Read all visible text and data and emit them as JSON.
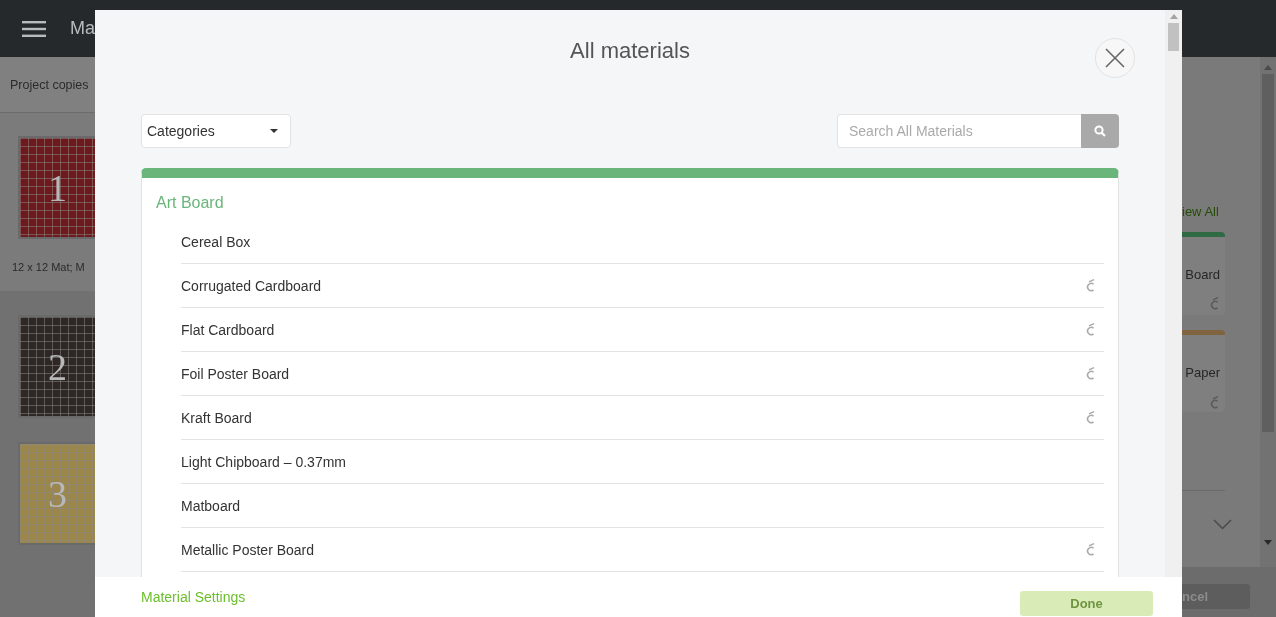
{
  "background": {
    "app_title": "Ma",
    "project_copies": "Project copies",
    "mats": [
      {
        "number": "1",
        "color": "#6e1a1c"
      },
      {
        "number": "2",
        "color": "#2e2724"
      },
      {
        "number": "3",
        "color": "#9c8648"
      }
    ],
    "mat_caption": "12 x 12 Mat; M",
    "view_all": "iew All",
    "material_cards": [
      {
        "label": "Board",
        "color": "#2f6a45"
      },
      {
        "label": "Paper",
        "color": "#80643f"
      }
    ],
    "cancel_button": "ncel"
  },
  "dialog": {
    "title": "All materials",
    "categories": {
      "value": "Categories"
    },
    "search": {
      "placeholder": "Search All Materials"
    },
    "section": {
      "title": "Art Board",
      "items": [
        {
          "name": "Cereal Box",
          "icon": false
        },
        {
          "name": "Corrugated Cardboard",
          "icon": true
        },
        {
          "name": "Flat Cardboard",
          "icon": true
        },
        {
          "name": "Foil Poster Board",
          "icon": true
        },
        {
          "name": "Kraft Board",
          "icon": true
        },
        {
          "name": "Light Chipboard – 0.37mm",
          "icon": false
        },
        {
          "name": "Matboard",
          "icon": false
        },
        {
          "name": "Metallic Poster Board",
          "icon": true
        }
      ]
    },
    "material_settings": "Material Settings",
    "done": {
      "label": "Done",
      "disabled": true
    }
  }
}
